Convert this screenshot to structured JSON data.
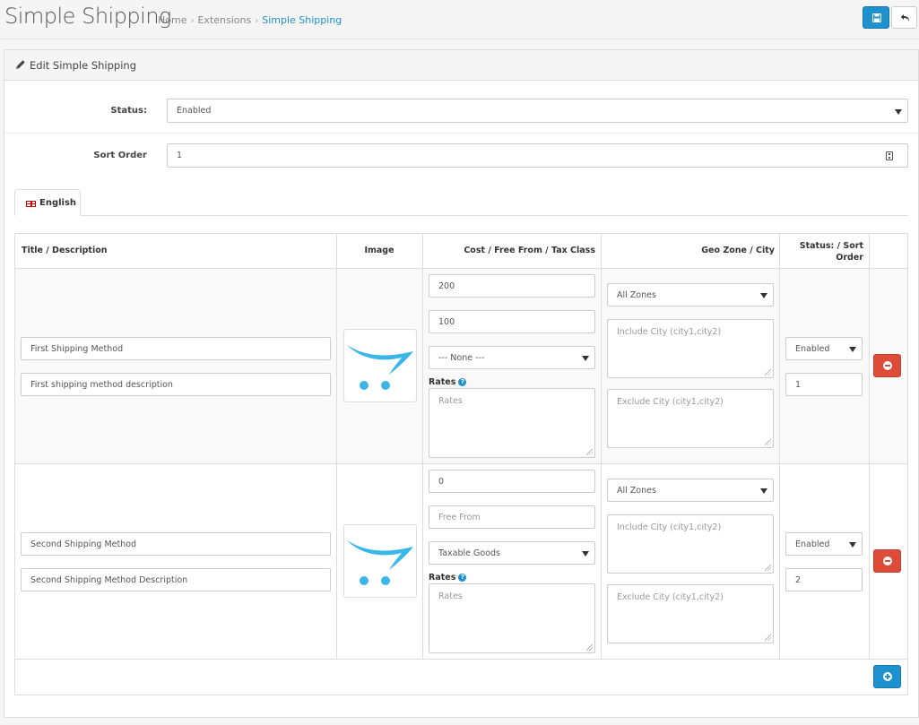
{
  "header": {
    "title": "Simple Shipping",
    "breadcrumb": [
      "Home",
      "Extensions",
      "Simple Shipping"
    ]
  },
  "panel": {
    "title": "Edit Simple Shipping"
  },
  "form": {
    "status_label": "Status:",
    "status_value": "Enabled",
    "sort_label": "Sort Order",
    "sort_value": "1"
  },
  "tabs": [
    {
      "label": "English"
    }
  ],
  "table": {
    "headers": [
      "Title / Description",
      "Image",
      "Cost / Free From / Tax Class",
      "Geo Zone / City",
      "Status: / Sort Order"
    ],
    "rows": [
      {
        "title": "First Shipping Method",
        "description": "First shipping method description",
        "cost": "200",
        "free_from": "100",
        "free_from_placeholder": "Free From",
        "tax_class": "--- None ---",
        "rates_label": "Rates",
        "rates_placeholder": "Rates",
        "geo_zone": "All Zones",
        "include_city": "Include City (city1,city2)",
        "exclude_city": "Exclude City (city1,city2)",
        "status": "Enabled",
        "sort_order": "1"
      },
      {
        "title": "Second Shipping Method",
        "description": "Second Shipping Method Description",
        "cost": "0",
        "free_from": "",
        "free_from_placeholder": "Free From",
        "tax_class": "Taxable Goods",
        "rates_label": "Rates",
        "rates_placeholder": "Rates",
        "geo_zone": "All Zones",
        "include_city": "Include City (city1,city2)",
        "exclude_city": "Exclude City (city1,city2)",
        "status": "Enabled",
        "sort_order": "2"
      }
    ]
  },
  "colors": {
    "primary": "#1e91cf",
    "danger": "#dd4b39",
    "cart_blue": "#3ab6e8"
  },
  "icons": {
    "save": "save-icon",
    "back": "reply-icon",
    "edit": "pencil-icon",
    "flag": "uk-flag-icon",
    "remove": "minus-circle-icon",
    "add": "plus-circle-icon",
    "help": "question-circle-icon"
  }
}
